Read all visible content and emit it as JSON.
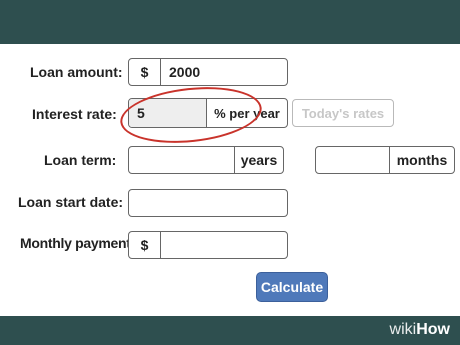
{
  "form": {
    "loan_amount": {
      "label": "Loan amount:",
      "prefix": "$",
      "value": "2000"
    },
    "interest_rate": {
      "label": "Interest rate:",
      "value": "5",
      "suffix": "% per year",
      "rates_button": "Today's rates"
    },
    "loan_term": {
      "label": "Loan term:",
      "years_value": "",
      "years_label": "years",
      "months_value": "",
      "months_label": "months"
    },
    "start_date": {
      "label": "Loan start date:",
      "value": ""
    },
    "monthly_payments": {
      "label": "Monthly payments:",
      "prefix": "$",
      "value": ""
    },
    "calculate_button": "Calculate"
  },
  "watermark": {
    "part1": "wiki",
    "part2": "How"
  },
  "colors": {
    "band": "#2e4f4f",
    "accent": "#4f79ba",
    "annotation": "#c9332b"
  }
}
